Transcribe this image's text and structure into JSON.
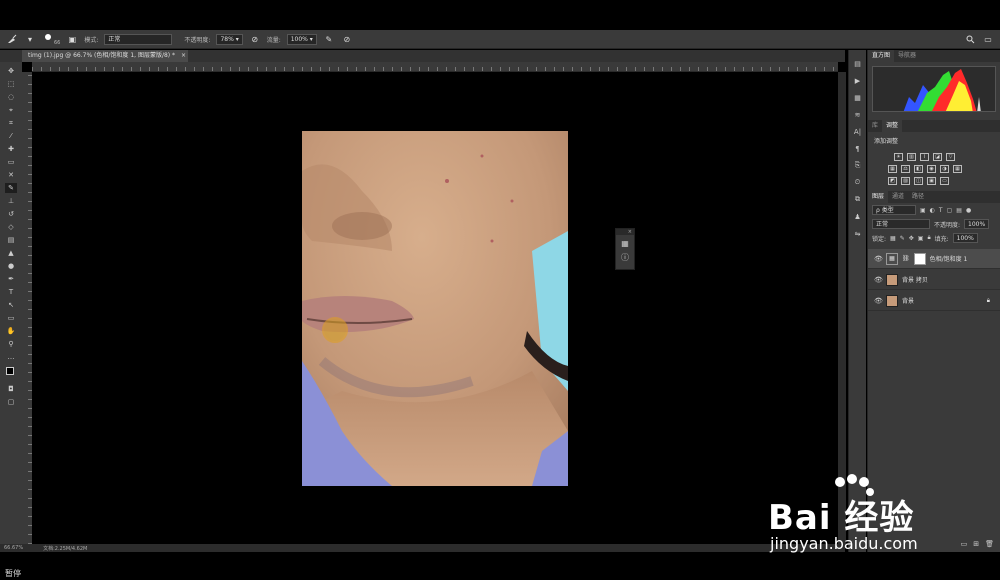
{
  "options_bar": {
    "brush_size": "66",
    "mode_label": "模式:",
    "mode_value": "正常",
    "opacity_label": "不透明度:",
    "opacity_value": "78%",
    "flow_label": "流量:",
    "flow_value": "100%"
  },
  "document_tab": {
    "title": "timg (1).jpg @ 66.7% (色相/饱和度 1, 图层蒙版/8) *",
    "close": "×"
  },
  "status_bar": {
    "zoom": "66.67%",
    "doc_info": "文档:2.25M/4.62M"
  },
  "bottom": {
    "state_text": "暂停"
  },
  "panels": {
    "top_tabs": [
      "直方图",
      "导航器"
    ],
    "mid_tabs": [
      "库",
      "调整"
    ],
    "adjust_heading": "添加调整",
    "layer_tabs": [
      "图层",
      "通道",
      "路径"
    ],
    "filter_kind": "ρ 类型",
    "blend_mode": "正常",
    "opacity_label": "不透明度:",
    "opacity_value": "100%",
    "lock_label": "锁定:",
    "fill_label": "填充:",
    "fill_value": "100%",
    "layers": [
      {
        "name": "色相/饱和度 1",
        "selected": true
      },
      {
        "name": "背景 拷贝",
        "selected": false
      },
      {
        "name": "背景",
        "selected": false
      }
    ]
  },
  "watermark": {
    "brand": "Bai 经验",
    "url": "jingyan.baidu.com"
  },
  "colors": {
    "ui_dark": "#3a3a3a",
    "ui_darker": "#262626",
    "brush_ring": "#e0a020"
  },
  "icons": {
    "brush_tool": "brush-icon",
    "search": "search-icon",
    "workspace": "workspace-icon"
  }
}
